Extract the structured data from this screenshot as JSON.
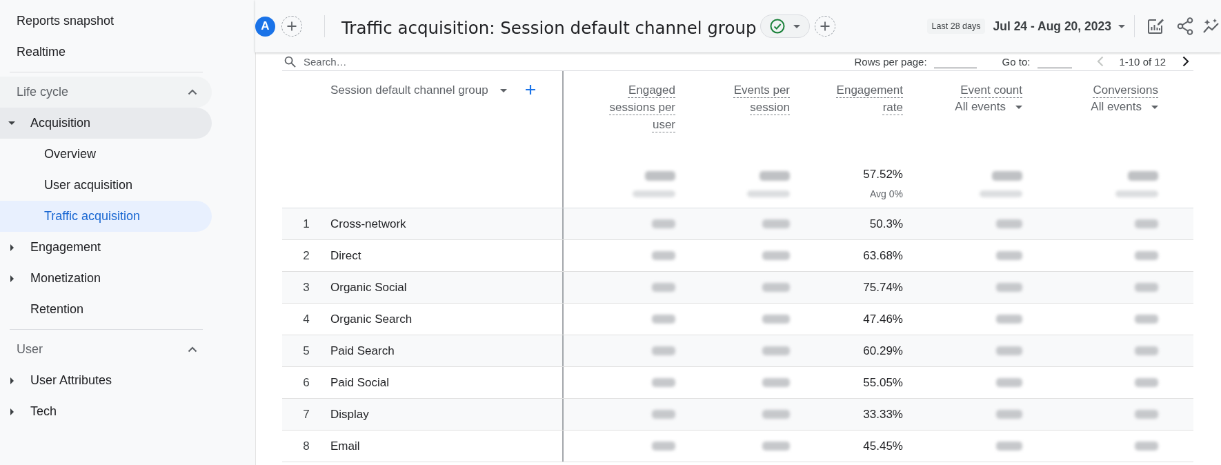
{
  "sidebar": {
    "top_items": [
      {
        "label": "Reports snapshot",
        "selected": false
      },
      {
        "label": "Realtime",
        "selected": false
      }
    ],
    "sections": [
      {
        "title": "Life cycle",
        "expanded": true,
        "items": [
          {
            "label": "Acquisition",
            "kind": "group",
            "expanded": true,
            "children": [
              {
                "label": "Overview",
                "selected": false
              },
              {
                "label": "User acquisition",
                "selected": false
              },
              {
                "label": "Traffic acquisition",
                "selected": true
              }
            ]
          },
          {
            "label": "Engagement",
            "kind": "group",
            "expanded": false
          },
          {
            "label": "Monetization",
            "kind": "group",
            "expanded": false
          },
          {
            "label": "Retention",
            "kind": "page",
            "selected": false
          }
        ]
      },
      {
        "title": "User",
        "expanded": true,
        "items": [
          {
            "label": "User Attributes",
            "kind": "group",
            "expanded": false
          },
          {
            "label": "Tech",
            "kind": "group",
            "expanded": false
          }
        ]
      }
    ]
  },
  "header": {
    "segment_badge": "A",
    "title": "Traffic acquisition: Session default channel group",
    "date_preset": "Last 28 days",
    "date_range": "Jul 24 - Aug 20, 2023"
  },
  "toolbar": {
    "search": {
      "placeholder": "Search…"
    },
    "rows_per_page_label": "Rows per page:",
    "go_to_label": "Go to:",
    "range": "1-10 of 12",
    "prev": {
      "disabled": true
    },
    "next": {
      "disabled": false
    }
  },
  "table": {
    "dimension_column": {
      "label": "Session default channel group"
    },
    "columns": [
      {
        "label": "Engaged sessions per user"
      },
      {
        "label": "Events per session"
      },
      {
        "label": "Engagement rate"
      },
      {
        "label": "Event count",
        "filter": "All events"
      },
      {
        "label": "Conversions",
        "filter": "All events"
      }
    ],
    "totals": [
      {
        "blurred": true
      },
      {
        "blurred": true
      },
      {
        "blurred": false,
        "value": "57.52%",
        "note": "Avg 0%"
      },
      {
        "blurred": true
      },
      {
        "blurred": true
      }
    ],
    "rows": [
      {
        "rank": "1",
        "channel": "Cross-network",
        "cells": [
          {
            "blurred": true
          },
          {
            "blurred": true
          },
          {
            "blurred": false,
            "value": "50.3%"
          },
          {
            "blurred": true
          },
          {
            "blurred": true
          }
        ]
      },
      {
        "rank": "2",
        "channel": "Direct",
        "cells": [
          {
            "blurred": true
          },
          {
            "blurred": true
          },
          {
            "blurred": false,
            "value": "63.68%"
          },
          {
            "blurred": true
          },
          {
            "blurred": true
          }
        ]
      },
      {
        "rank": "3",
        "channel": "Organic Social",
        "cells": [
          {
            "blurred": true
          },
          {
            "blurred": true
          },
          {
            "blurred": false,
            "value": "75.74%"
          },
          {
            "blurred": true
          },
          {
            "blurred": true
          }
        ]
      },
      {
        "rank": "4",
        "channel": "Organic Search",
        "cells": [
          {
            "blurred": true
          },
          {
            "blurred": true
          },
          {
            "blurred": false,
            "value": "47.46%"
          },
          {
            "blurred": true
          },
          {
            "blurred": true
          }
        ]
      },
      {
        "rank": "5",
        "channel": "Paid Search",
        "cells": [
          {
            "blurred": true
          },
          {
            "blurred": true
          },
          {
            "blurred": false,
            "value": "60.29%"
          },
          {
            "blurred": true
          },
          {
            "blurred": true
          }
        ]
      },
      {
        "rank": "6",
        "channel": "Paid Social",
        "cells": [
          {
            "blurred": true
          },
          {
            "blurred": true
          },
          {
            "blurred": false,
            "value": "55.05%"
          },
          {
            "blurred": true
          },
          {
            "blurred": true
          }
        ]
      },
      {
        "rank": "7",
        "channel": "Display",
        "cells": [
          {
            "blurred": true
          },
          {
            "blurred": true
          },
          {
            "blurred": false,
            "value": "33.33%"
          },
          {
            "blurred": true
          },
          {
            "blurred": true
          }
        ]
      },
      {
        "rank": "8",
        "channel": "Email",
        "cells": [
          {
            "blurred": true
          },
          {
            "blurred": true
          },
          {
            "blurred": false,
            "value": "45.45%"
          },
          {
            "blurred": true
          },
          {
            "blurred": true
          }
        ]
      }
    ]
  }
}
